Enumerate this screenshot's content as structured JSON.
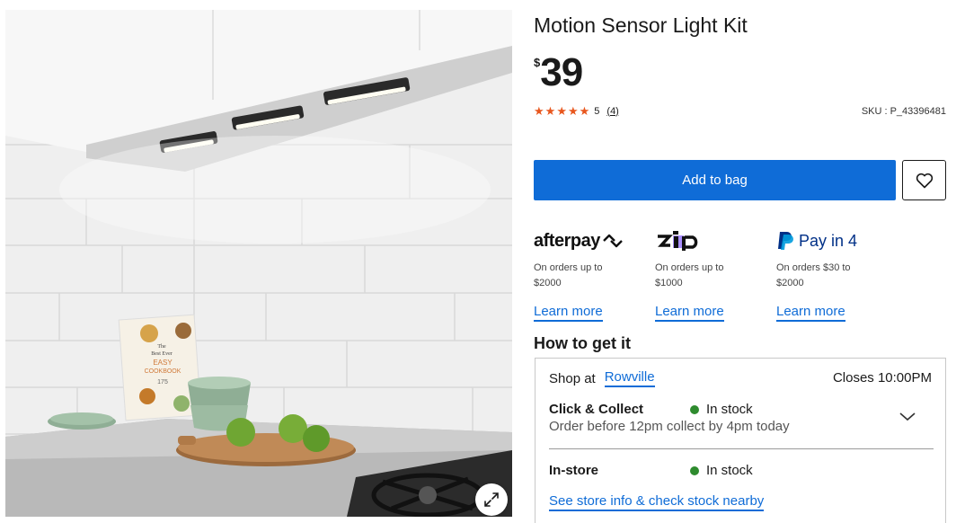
{
  "product": {
    "title": "Motion Sensor Light Kit",
    "currency_symbol": "$",
    "price": "39",
    "rating_value": "5",
    "review_count": "(4)",
    "stars": 5,
    "sku": "SKU : P_43396481"
  },
  "image": {
    "book_title_line1": "The",
    "book_title_line2": "Best Ever",
    "book_title_line3": "EASY",
    "book_title_line4": "COOKBOOK",
    "book_number": "175"
  },
  "actions": {
    "add_to_bag": "Add to bag"
  },
  "payments": [
    {
      "brand": "afterpay",
      "logo_text": "afterpay",
      "line1": "On orders up to",
      "line2": "$2000",
      "link": "Learn more"
    },
    {
      "brand": "zip",
      "logo_text": "zip",
      "line1": "On orders up to",
      "line2": "$1000",
      "link": "Learn more"
    },
    {
      "brand": "paypal",
      "logo_text": "Pay in 4",
      "line1": "On orders $30 to",
      "line2": "$2000",
      "link": "Learn more"
    }
  ],
  "fulfilment": {
    "heading": "How to get it",
    "shop_at": "Shop at",
    "store_name": "Rowville",
    "closes": "Closes 10:00PM",
    "click_collect": {
      "label": "Click & Collect",
      "status": "In stock",
      "note": "Order before 12pm collect by 4pm today"
    },
    "in_store": {
      "label": "In-store",
      "status": "In stock"
    },
    "store_info_link": "See store info & check stock nearby"
  },
  "colors": {
    "primary_blue": "#0f6cd7",
    "star_orange": "#e8571e",
    "stock_green": "#2e8b2e",
    "zip_purple": "#aa8fff",
    "paypal_navy": "#003087",
    "paypal_blue": "#009cde"
  },
  "icons": {
    "wishlist": "heart-icon",
    "zoom": "expand-icon",
    "chevron": "chevron-down-icon",
    "star": "star-icon"
  }
}
